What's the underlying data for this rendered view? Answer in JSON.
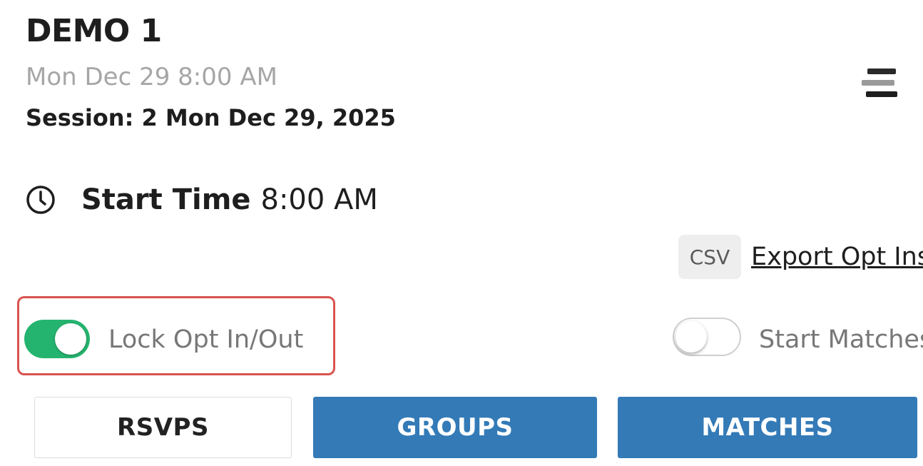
{
  "event": {
    "title": "DEMO 1",
    "datetime": "Mon Dec 29 8:00 AM",
    "session": "Session: 2 Mon Dec 29, 2025"
  },
  "header": {
    "menu_icon": "hamburger-menu-icon"
  },
  "start_time": {
    "icon": "clock-icon",
    "label": "Start Time",
    "value": "8:00 AM"
  },
  "export": {
    "badge": "CSV",
    "link_label": "Export Opt Ins"
  },
  "toggles": {
    "lock": {
      "label": "Lock Opt In/Out",
      "state": true,
      "on_color": "#25b46f"
    },
    "start_matches": {
      "label": "Start Matches",
      "state": false
    }
  },
  "highlight_color": "#d9534f",
  "tabs": [
    {
      "label": "RSVPS",
      "active": false
    },
    {
      "label": "GROUPS",
      "active": true
    },
    {
      "label": "MATCHES",
      "active": true
    }
  ],
  "accent_color": "#337ab7"
}
